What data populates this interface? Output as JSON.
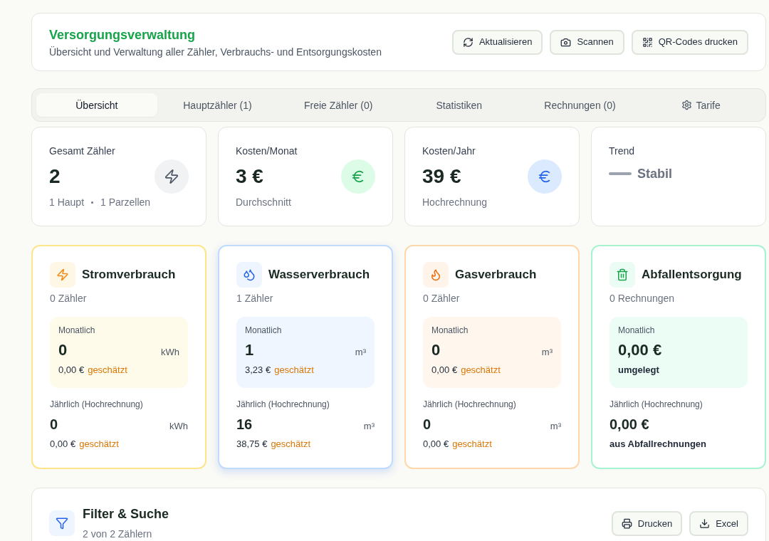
{
  "header": {
    "title": "Versorgungsverwaltung",
    "subtitle": "Übersicht und Verwaltung aller Zähler, Verbrauchs- und Entsorgungskosten",
    "buttons": [
      "Aktualisieren",
      "Scannen",
      "QR-Codes drucken"
    ]
  },
  "tabs": [
    {
      "label": "Übersicht",
      "selected": true
    },
    {
      "label": "Hauptzähler (1)",
      "selected": false
    },
    {
      "label": "Freie Zähler (0)",
      "selected": false
    },
    {
      "label": "Statistiken",
      "selected": false
    },
    {
      "label": "Rechnungen (0)",
      "selected": false
    },
    {
      "label": "Tarife",
      "selected": false
    }
  ],
  "stats": [
    {
      "kind": "count",
      "label": "Gesamt Zähler",
      "value": "2",
      "notes": [
        "1 Haupt",
        "1 Parzellen"
      ]
    },
    {
      "kind": "cost",
      "label": "Kosten/Monat",
      "value": "3 €",
      "notes": [
        "Durchschnitt"
      ]
    },
    {
      "kind": "cost",
      "label": "Kosten/Jahr",
      "value": "39 €",
      "notes": [
        "Hochrechnung"
      ]
    },
    {
      "kind": "trend",
      "label": "Trend",
      "value": "Stabil"
    }
  ],
  "categories": [
    {
      "kind": "meter",
      "title": "Stromverbrauch",
      "subtitle": "0 Zähler",
      "selected": false,
      "monthly": {
        "label": "Monatlich",
        "value": "0",
        "unit": "kWh",
        "cost": "0,00 €",
        "cost_note": "geschätzt"
      },
      "yearly": {
        "label": "Jährlich (Hochrechnung)",
        "value": "0",
        "unit": "kWh",
        "cost": "0,00 €",
        "cost_note": "geschätzt"
      }
    },
    {
      "kind": "meter",
      "title": "Wasserverbrauch",
      "subtitle": "1 Zähler",
      "selected": true,
      "monthly": {
        "label": "Monatlich",
        "value": "1",
        "unit": "m³",
        "cost": "3,23 €",
        "cost_note": "geschätzt"
      },
      "yearly": {
        "label": "Jährlich (Hochrechnung)",
        "value": "16",
        "unit": "m³",
        "cost": "38,75 €",
        "cost_note": "geschätzt"
      }
    },
    {
      "kind": "meter",
      "title": "Gasverbrauch",
      "subtitle": "0 Zähler",
      "selected": false,
      "monthly": {
        "label": "Monatlich",
        "value": "0",
        "unit": "m³",
        "cost": "0,00 €",
        "cost_note": "geschätzt"
      },
      "yearly": {
        "label": "Jährlich (Hochrechnung)",
        "value": "0",
        "unit": "m³",
        "cost": "0,00 €",
        "cost_note": "geschätzt"
      }
    },
    {
      "kind": "waste",
      "title": "Abfallentsorgung",
      "subtitle": "0 Rechnungen",
      "selected": false,
      "monthly": {
        "label": "Monatlich",
        "value": "0,00 €",
        "note": "umgelegt"
      },
      "yearly": {
        "label": "Jährlich (Hochrechnung)",
        "value": "0,00 €",
        "note": "aus Abfallrechnungen"
      }
    }
  ],
  "filter": {
    "title": "Filter & Suche",
    "subtitle": "2 von 2 Zählern",
    "buttons": [
      "Drucken",
      "Excel"
    ]
  }
}
